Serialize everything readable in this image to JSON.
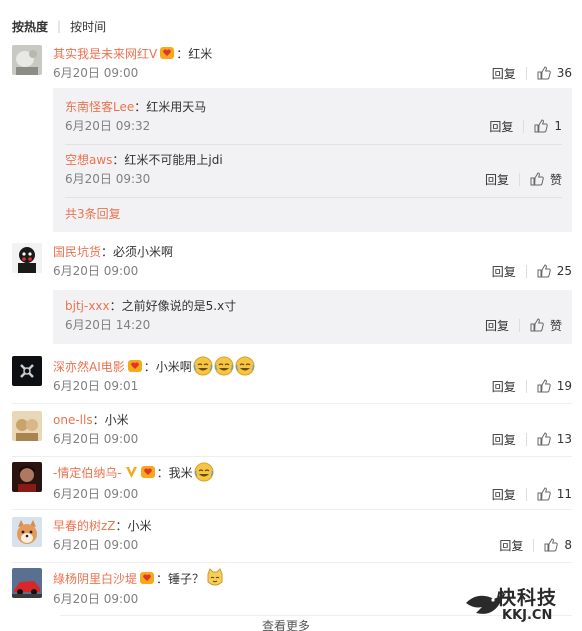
{
  "sort": {
    "hot": "按热度",
    "time": "按时间"
  },
  "actions": {
    "reply": "回复",
    "zan": "赞"
  },
  "comments": [
    {
      "user": "其实我是未来网红V",
      "badge": "vip",
      "text": "：红米",
      "time": "6月20日 09:00",
      "likes": "36",
      "replies": [
        {
          "user": "东南怪客Lee",
          "text": "：红米用天马",
          "time": "6月20日 09:32",
          "likes": "1"
        },
        {
          "user": "空想aws",
          "text": "：红米不可能用上jdi",
          "time": "6月20日 09:30",
          "likes": "赞"
        }
      ],
      "more": "共3条回复"
    },
    {
      "user": "国民坑货",
      "text": "：必须小米啊",
      "time": "6月20日 09:00",
      "likes": "25",
      "replies": [
        {
          "user": "bjtj-xxx",
          "text": "：之前好像说的是5.x寸",
          "time": "6月20日 14:20",
          "likes": "赞"
        }
      ]
    },
    {
      "user": "深亦然AI电影",
      "badge": "vip",
      "text": "：小米啊",
      "emoji": [
        "laugh-cry",
        "laugh-cry",
        "laugh-cry"
      ],
      "time": "6月20日 09:01",
      "likes": "19"
    },
    {
      "user": "one-lls",
      "text": "：小米",
      "time": "6月20日 09:00",
      "likes": "13"
    },
    {
      "user": "-情定伯纳乌-",
      "badge": "v-vip",
      "text": "：我米",
      "emoji": [
        "laugh-cry"
      ],
      "time": "6月20日 09:00",
      "likes": "11"
    },
    {
      "user": "早春的树zZ",
      "text": "：小米",
      "time": "6月20日 09:00",
      "likes": "8"
    },
    {
      "user": "綠杨阴里白沙堤",
      "badge": "vip",
      "text": "：锤子？",
      "emoji": [
        "cat-face"
      ],
      "time": "6月20日 09:00",
      "likes": ""
    }
  ],
  "watermark": {
    "title": "快科技",
    "url": "KKJ.CN"
  },
  "bottom": {
    "more": "查看更多"
  },
  "colors": {
    "username": "#eb7350",
    "reply_bg": "#f2f2f5",
    "time": "#808080"
  },
  "icons": {
    "like": "thumbs-up-icon",
    "vip": "vip-heart-badge-icon",
    "v": "verified-v-icon"
  }
}
